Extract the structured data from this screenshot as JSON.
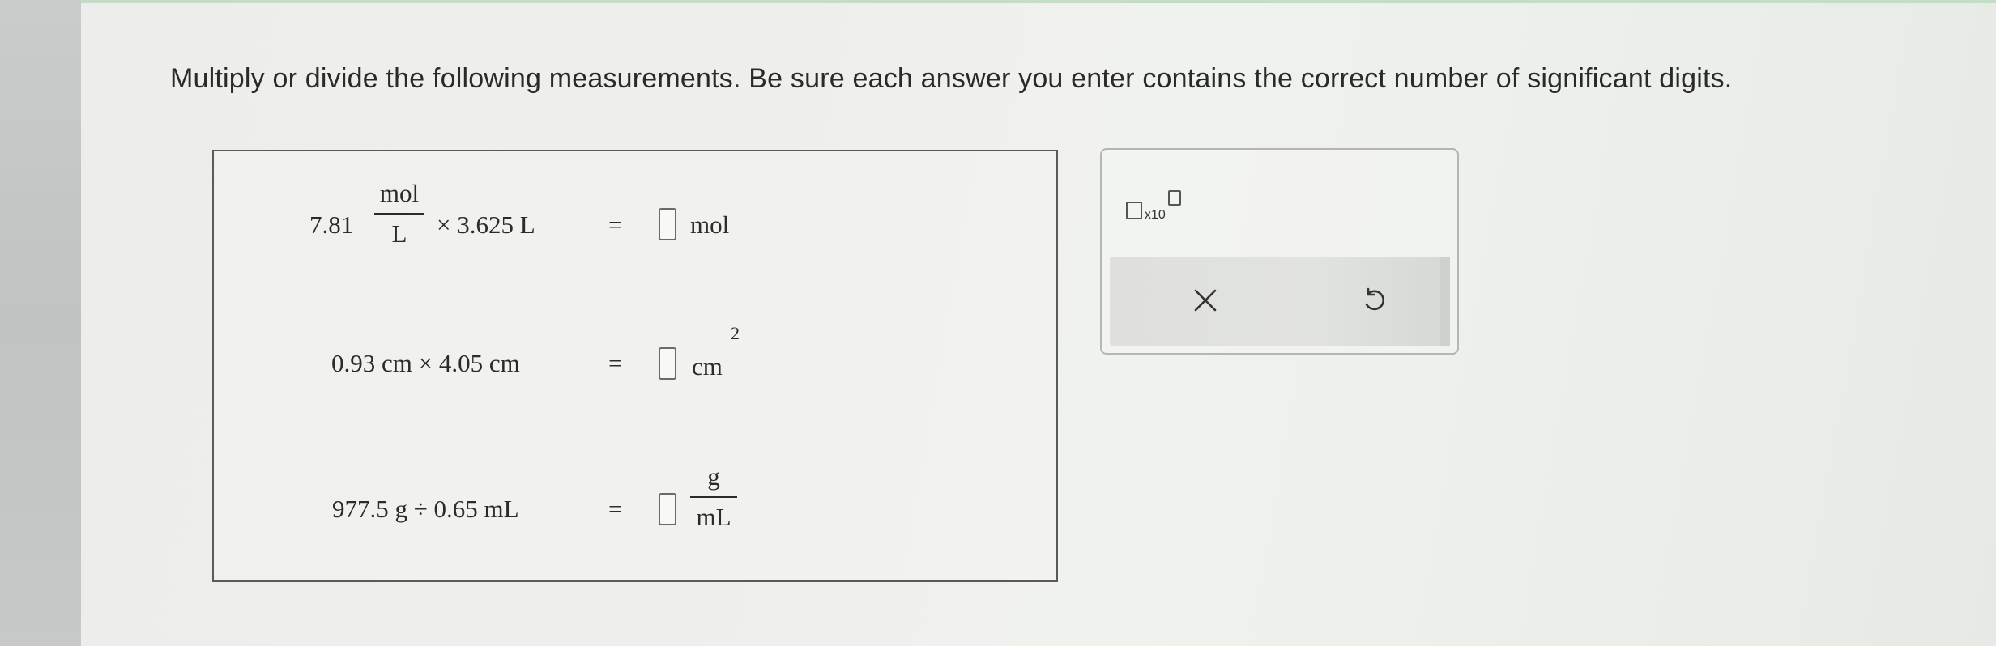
{
  "instructions": "Multiply or divide the following measurements. Be sure each answer you enter contains the correct number of significant digits.",
  "equations": [
    {
      "lhs_coefficient": "7.81",
      "lhs_fraction": {
        "numerator": "mol",
        "denominator": "L"
      },
      "lhs_rest": "× 3.625 L",
      "equals": "=",
      "answer": "",
      "unit": "mol"
    },
    {
      "lhs": "0.93 cm × 4.05 cm",
      "equals": "=",
      "answer": "",
      "unit": "cm",
      "unit_exponent": "2"
    },
    {
      "lhs": "977.5 g ÷ 0.65 mL",
      "equals": "=",
      "answer": "",
      "unit_fraction": {
        "numerator": "g",
        "denominator": "mL"
      }
    }
  ],
  "tools": {
    "sci_notation_label": "x10",
    "clear_icon": "close-icon",
    "undo_icon": "undo-icon"
  }
}
